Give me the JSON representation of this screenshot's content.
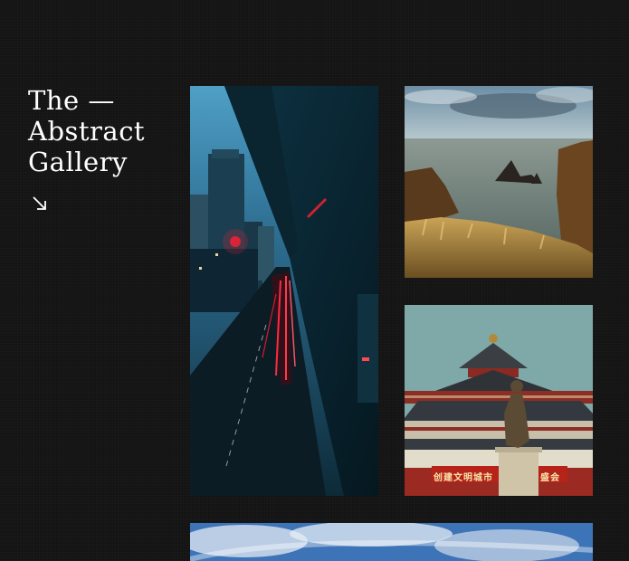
{
  "gallery": {
    "title_lines": [
      "The —",
      "Abstract",
      "Gallery"
    ],
    "arrow_icon": "arrow-down-right-icon"
  },
  "photos": [
    {
      "name": "city-night-photo",
      "sign": ""
    },
    {
      "name": "coastal-rocks-photo",
      "sign": ""
    },
    {
      "name": "temple-statue-photo",
      "sign": "创建文明城市",
      "sign2": "盛会"
    },
    {
      "name": "cloudy-sky-photo",
      "sign": ""
    }
  ],
  "colors": {
    "background": "#141414",
    "title": "#ffffff"
  }
}
